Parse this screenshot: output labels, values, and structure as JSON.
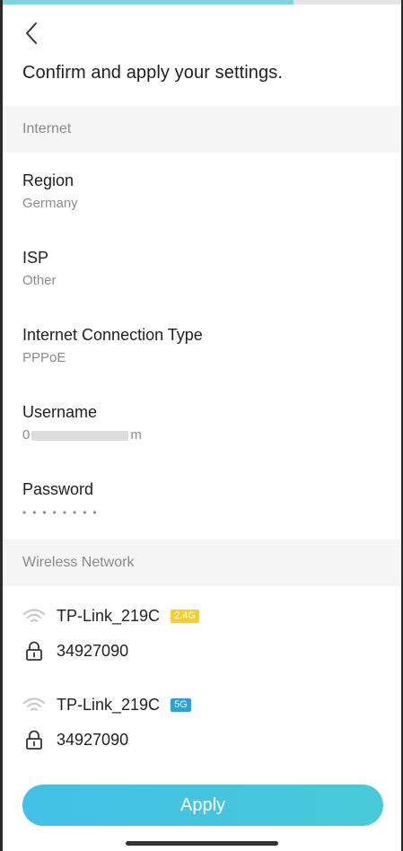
{
  "progress": {
    "value_percent": 73
  },
  "header": {
    "back_icon": "chevron-left-icon",
    "title": "Confirm and apply your settings."
  },
  "internet": {
    "section_title": "Internet",
    "region": {
      "label": "Region",
      "value": "Germany"
    },
    "isp": {
      "label": "ISP",
      "value": "Other"
    },
    "connection_type": {
      "label": "Internet Connection Type",
      "value": "PPPoE"
    },
    "username": {
      "label": "Username",
      "value_prefix": "0",
      "value_suffix": "m"
    },
    "password": {
      "label": "Password",
      "value": "••••••••"
    }
  },
  "wireless": {
    "section_title": "Wireless Network",
    "networks": [
      {
        "ssid": "TP-Link_219C",
        "band": "2.4G",
        "band_color": "#f7cf2c",
        "password": "34927090"
      },
      {
        "ssid": "TP-Link_219C",
        "band": "5G",
        "band_color": "#2f9fd6",
        "password": "34927090"
      }
    ]
  },
  "footer": {
    "apply_label": "Apply"
  }
}
